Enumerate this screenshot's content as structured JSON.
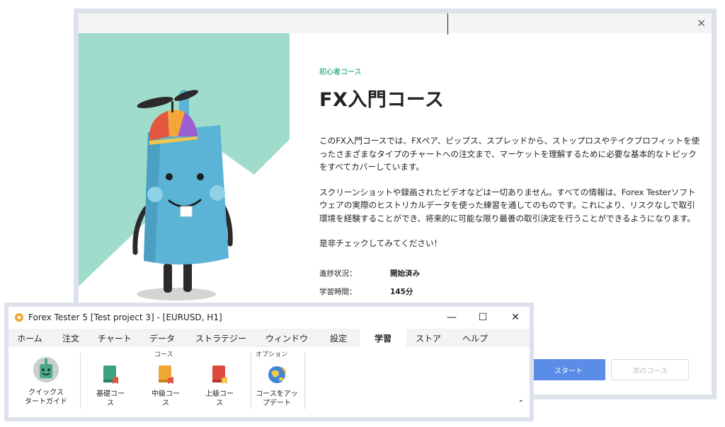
{
  "dialog": {
    "close_icon": "close-icon",
    "course_tag": "初心者コース",
    "title": "FX入門コース",
    "paragraphs": [
      "このFX入門コースでは、FXペア、ピップス、スプレッドから、ストップロスやテイクプロフィットを使ったさまざまなタイプのチャートへの注文まで、マーケットを理解するために必要な基本的なトピックをすべてカバーしています。",
      "スクリーンショットや録画されたビデオなどは一切ありません。すべての情報は、Forex Testerソフトウェアの実際のヒストリカルデータを使った練習を通してのものです。これにより、リスクなしで取引環境を経験することができ、将来的に可能な限り最善の取引決定を行うことができるようになります。",
      "是非チェックしてみてください！"
    ],
    "meta": [
      {
        "label": "進捗状況：",
        "value": "開始済み"
      },
      {
        "label": "学習時間：",
        "value": "145分"
      }
    ],
    "start_button": "スタート",
    "next_button": "次のコース"
  },
  "forex_window": {
    "title": "Forex Tester 5  [Test project 3] - [EURUSD, H1]",
    "window_controls": {
      "minimize": "—",
      "maximize": "☐",
      "close": "✕"
    },
    "menu": [
      {
        "label": "ホーム",
        "active": false
      },
      {
        "label": "注文",
        "active": false
      },
      {
        "label": "チャート",
        "active": false
      },
      {
        "label": "データ",
        "active": false
      },
      {
        "label": "ストラテジー",
        "active": false
      },
      {
        "label": "ウィンドウ",
        "active": false
      },
      {
        "label": "設定",
        "active": false
      },
      {
        "label": "学習",
        "active": true
      },
      {
        "label": "ストア",
        "active": false
      },
      {
        "label": "ヘルプ",
        "active": false
      }
    ],
    "ribbon": {
      "group_course": "コース",
      "group_option": "オプション",
      "quick_start": {
        "line1": "クイックス",
        "line2": "タートガイド"
      },
      "basic_course": {
        "line1": "基礎コー",
        "line2": "ス"
      },
      "intermediate_course": {
        "line1": "中級コー",
        "line2": "ス"
      },
      "advanced_course": {
        "line1": "上級コー",
        "line2": "ス"
      },
      "update_course": {
        "line1": "コースをアッ",
        "line2": "プデート"
      },
      "collapse": "⌃"
    }
  },
  "colors": {
    "mint": "#9fdccb",
    "robot_blue": "#5bb3d6",
    "start_button": "#5b8de8",
    "basic_book": "#3fa27f",
    "intermediate_book": "#f0a632",
    "advanced_book": "#dd4a3e"
  }
}
